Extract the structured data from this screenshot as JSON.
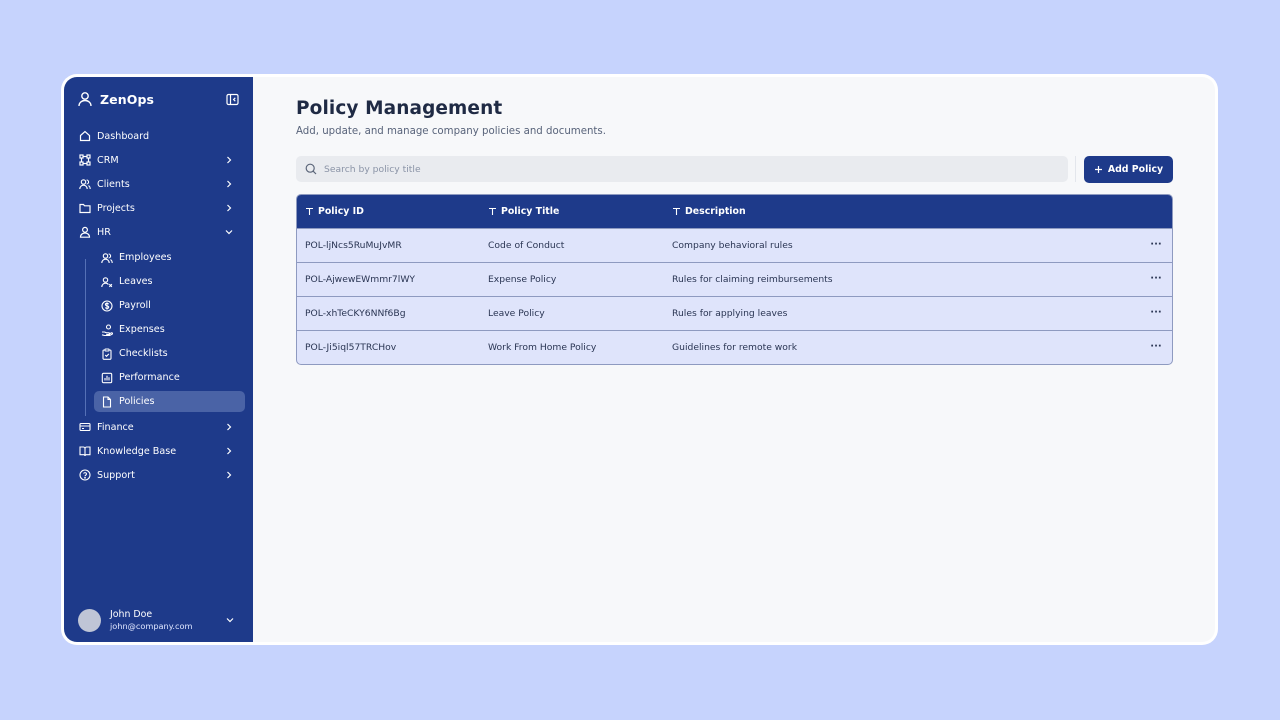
{
  "app": {
    "name": "ZenOps"
  },
  "sidebar": {
    "items": [
      {
        "label": "Dashboard",
        "icon": "home-icon"
      },
      {
        "label": "CRM",
        "icon": "crm-icon"
      },
      {
        "label": "Clients",
        "icon": "users-icon"
      },
      {
        "label": "Projects",
        "icon": "folder-icon"
      },
      {
        "label": "HR",
        "icon": "person-icon"
      }
    ],
    "hr_subitems": [
      {
        "label": "Employees",
        "icon": "users-icon"
      },
      {
        "label": "Leaves",
        "icon": "user-x-icon"
      },
      {
        "label": "Payroll",
        "icon": "dollar-circle-icon"
      },
      {
        "label": "Expenses",
        "icon": "hand-coins-icon"
      },
      {
        "label": "Checklists",
        "icon": "clipboard-check-icon"
      },
      {
        "label": "Performance",
        "icon": "bar-chart-icon"
      },
      {
        "label": "Policies",
        "icon": "file-icon",
        "active": true
      }
    ],
    "bottom_items": [
      {
        "label": "Finance",
        "icon": "credit-card-icon"
      },
      {
        "label": "Knowledge Base",
        "icon": "book-icon"
      },
      {
        "label": "Support",
        "icon": "help-circle-icon"
      }
    ]
  },
  "user": {
    "name": "John Doe",
    "email": "john@company.com"
  },
  "page": {
    "title": "Policy Management",
    "subtitle": "Add, update, and manage company policies and documents."
  },
  "search": {
    "placeholder": "Search by policy title",
    "value": ""
  },
  "toolbar": {
    "add_label": "Add Policy"
  },
  "table": {
    "columns": [
      "Policy ID",
      "Policy Title",
      "Description"
    ],
    "rows": [
      [
        "POL-ljNcs5RuMuJvMR",
        "Code of Conduct",
        "Company behavioral rules"
      ],
      [
        "POL-AjwewEWmmr7lWY",
        "Expense Policy",
        "Rules for claiming reimbursements"
      ],
      [
        "POL-xhTeCKY6NNf6Bg",
        "Leave Policy",
        "Rules for applying leaves"
      ],
      [
        "POL-Ji5iql57TRCHov",
        "Work From Home Policy",
        "Guidelines for remote work"
      ]
    ],
    "row_action": "···"
  },
  "colors": {
    "background": "#c6d3fd",
    "sidebar": "#1e3a8a",
    "accent": "#1e3a8a",
    "active_item": "#4a63a6",
    "table_row": "#dfe4fb"
  }
}
